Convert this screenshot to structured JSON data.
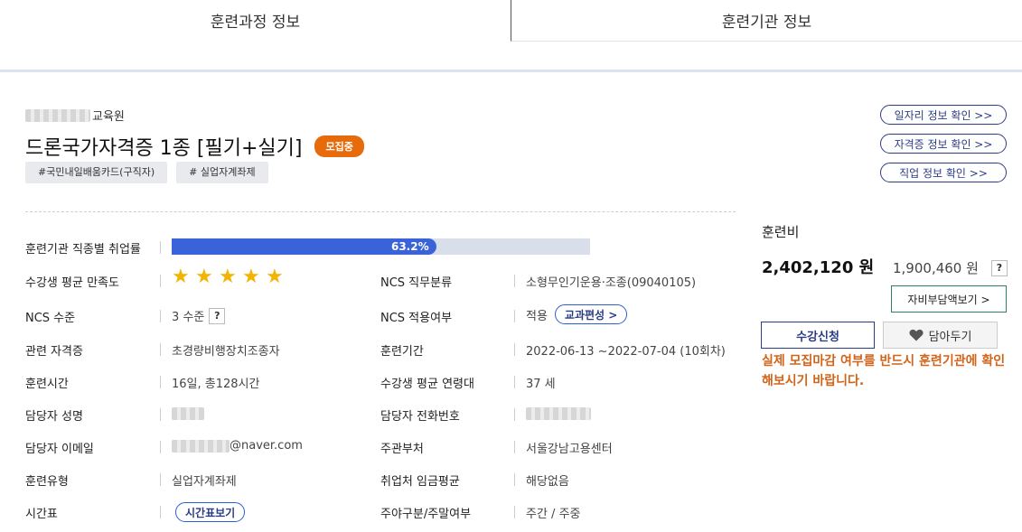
{
  "tabs": [
    {
      "label": "훈련과정 정보"
    },
    {
      "label": "훈련기관 정보"
    }
  ],
  "header": {
    "org_suffix": "교육원",
    "title": "드론국가자격증 1종 [필기+실기]",
    "status_badge": "모집중",
    "tags": [
      "#국민내일배움카드(구직자)",
      "# 실업자계좌제"
    ]
  },
  "links": {
    "job_info": "일자리 정보 확인 >>",
    "cert_info": "자격증 정보 확인 >>",
    "occupation_info": "직업 정보 확인 >>"
  },
  "info": {
    "employment_rate": {
      "label": "훈련기관 직종별 취업률",
      "value": "63.2%",
      "fraction": 0.632
    },
    "satisfaction": {
      "label": "수강생 평균 만족도",
      "stars": 5
    },
    "ncs_job": {
      "label": "NCS 직무분류",
      "value": "소형무인기운용·조종(09040105)"
    },
    "ncs_level": {
      "label": "NCS 수준",
      "value": "3 수준",
      "help": "?"
    },
    "ncs_apply": {
      "label": "NCS 적용여부",
      "value": "적용",
      "button": "교과편성 >"
    },
    "related_cert": {
      "label": "관련 자격증",
      "value": "초경량비행장치조종자"
    },
    "period": {
      "label": "훈련기간",
      "value": "2022-06-13 ~2022-07-04 (10회차)"
    },
    "hours": {
      "label": "훈련시간",
      "value": "16일, 총128시간"
    },
    "avg_age": {
      "label": "수강생 평균 연령대",
      "value": "37 세"
    },
    "manager_name": {
      "label": "담당자 성명"
    },
    "manager_phone": {
      "label": "담당자 전화번호"
    },
    "manager_email": {
      "label": "담당자 이메일",
      "value": "@naver.com"
    },
    "department": {
      "label": "주관부처",
      "value": "서울강남고용센터"
    },
    "training_type": {
      "label": "훈련유형",
      "value": "실업자계좌제"
    },
    "wage": {
      "label": "취업처 임금평균",
      "value": "해당없음"
    },
    "timetable": {
      "label": "시간표",
      "button": "시간표보기"
    },
    "day_type": {
      "label": "주야구분/주말여부",
      "value": "주간 / 주중"
    }
  },
  "fee": {
    "title": "훈련비",
    "amount": "2,402,120 원",
    "support_amount": "1,900,460 원",
    "help": "?",
    "self_pay_button": "자비부담액보기 >",
    "apply_button": "수강신청",
    "save_button": "담아두기",
    "warning": "실제 모집마감 여부를 반드시 훈련기관에 확인해보시기 바랍니다."
  },
  "colors": {
    "accent": "#2b3c86",
    "progress": "#3b63d9",
    "badge": "#e86b0b",
    "star": "#f1b400",
    "warning": "#d2641a"
  }
}
